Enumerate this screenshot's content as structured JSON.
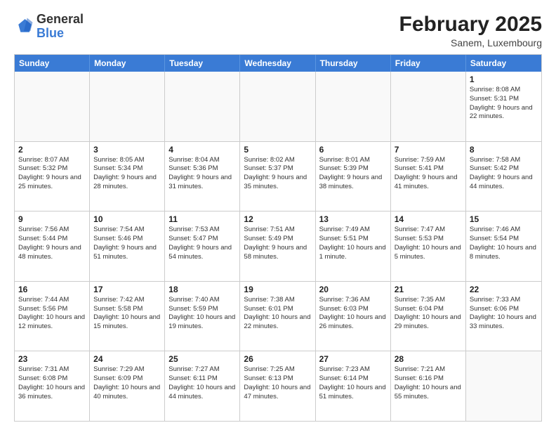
{
  "logo": {
    "general": "General",
    "blue": "Blue"
  },
  "title": "February 2025",
  "subtitle": "Sanem, Luxembourg",
  "days": [
    "Sunday",
    "Monday",
    "Tuesday",
    "Wednesday",
    "Thursday",
    "Friday",
    "Saturday"
  ],
  "weeks": [
    [
      {
        "day": "",
        "info": ""
      },
      {
        "day": "",
        "info": ""
      },
      {
        "day": "",
        "info": ""
      },
      {
        "day": "",
        "info": ""
      },
      {
        "day": "",
        "info": ""
      },
      {
        "day": "",
        "info": ""
      },
      {
        "day": "1",
        "info": "Sunrise: 8:08 AM\nSunset: 5:31 PM\nDaylight: 9 hours and 22 minutes."
      }
    ],
    [
      {
        "day": "2",
        "info": "Sunrise: 8:07 AM\nSunset: 5:32 PM\nDaylight: 9 hours and 25 minutes."
      },
      {
        "day": "3",
        "info": "Sunrise: 8:05 AM\nSunset: 5:34 PM\nDaylight: 9 hours and 28 minutes."
      },
      {
        "day": "4",
        "info": "Sunrise: 8:04 AM\nSunset: 5:36 PM\nDaylight: 9 hours and 31 minutes."
      },
      {
        "day": "5",
        "info": "Sunrise: 8:02 AM\nSunset: 5:37 PM\nDaylight: 9 hours and 35 minutes."
      },
      {
        "day": "6",
        "info": "Sunrise: 8:01 AM\nSunset: 5:39 PM\nDaylight: 9 hours and 38 minutes."
      },
      {
        "day": "7",
        "info": "Sunrise: 7:59 AM\nSunset: 5:41 PM\nDaylight: 9 hours and 41 minutes."
      },
      {
        "day": "8",
        "info": "Sunrise: 7:58 AM\nSunset: 5:42 PM\nDaylight: 9 hours and 44 minutes."
      }
    ],
    [
      {
        "day": "9",
        "info": "Sunrise: 7:56 AM\nSunset: 5:44 PM\nDaylight: 9 hours and 48 minutes."
      },
      {
        "day": "10",
        "info": "Sunrise: 7:54 AM\nSunset: 5:46 PM\nDaylight: 9 hours and 51 minutes."
      },
      {
        "day": "11",
        "info": "Sunrise: 7:53 AM\nSunset: 5:47 PM\nDaylight: 9 hours and 54 minutes."
      },
      {
        "day": "12",
        "info": "Sunrise: 7:51 AM\nSunset: 5:49 PM\nDaylight: 9 hours and 58 minutes."
      },
      {
        "day": "13",
        "info": "Sunrise: 7:49 AM\nSunset: 5:51 PM\nDaylight: 10 hours and 1 minute."
      },
      {
        "day": "14",
        "info": "Sunrise: 7:47 AM\nSunset: 5:53 PM\nDaylight: 10 hours and 5 minutes."
      },
      {
        "day": "15",
        "info": "Sunrise: 7:46 AM\nSunset: 5:54 PM\nDaylight: 10 hours and 8 minutes."
      }
    ],
    [
      {
        "day": "16",
        "info": "Sunrise: 7:44 AM\nSunset: 5:56 PM\nDaylight: 10 hours and 12 minutes."
      },
      {
        "day": "17",
        "info": "Sunrise: 7:42 AM\nSunset: 5:58 PM\nDaylight: 10 hours and 15 minutes."
      },
      {
        "day": "18",
        "info": "Sunrise: 7:40 AM\nSunset: 5:59 PM\nDaylight: 10 hours and 19 minutes."
      },
      {
        "day": "19",
        "info": "Sunrise: 7:38 AM\nSunset: 6:01 PM\nDaylight: 10 hours and 22 minutes."
      },
      {
        "day": "20",
        "info": "Sunrise: 7:36 AM\nSunset: 6:03 PM\nDaylight: 10 hours and 26 minutes."
      },
      {
        "day": "21",
        "info": "Sunrise: 7:35 AM\nSunset: 6:04 PM\nDaylight: 10 hours and 29 minutes."
      },
      {
        "day": "22",
        "info": "Sunrise: 7:33 AM\nSunset: 6:06 PM\nDaylight: 10 hours and 33 minutes."
      }
    ],
    [
      {
        "day": "23",
        "info": "Sunrise: 7:31 AM\nSunset: 6:08 PM\nDaylight: 10 hours and 36 minutes."
      },
      {
        "day": "24",
        "info": "Sunrise: 7:29 AM\nSunset: 6:09 PM\nDaylight: 10 hours and 40 minutes."
      },
      {
        "day": "25",
        "info": "Sunrise: 7:27 AM\nSunset: 6:11 PM\nDaylight: 10 hours and 44 minutes."
      },
      {
        "day": "26",
        "info": "Sunrise: 7:25 AM\nSunset: 6:13 PM\nDaylight: 10 hours and 47 minutes."
      },
      {
        "day": "27",
        "info": "Sunrise: 7:23 AM\nSunset: 6:14 PM\nDaylight: 10 hours and 51 minutes."
      },
      {
        "day": "28",
        "info": "Sunrise: 7:21 AM\nSunset: 6:16 PM\nDaylight: 10 hours and 55 minutes."
      },
      {
        "day": "",
        "info": ""
      }
    ]
  ]
}
